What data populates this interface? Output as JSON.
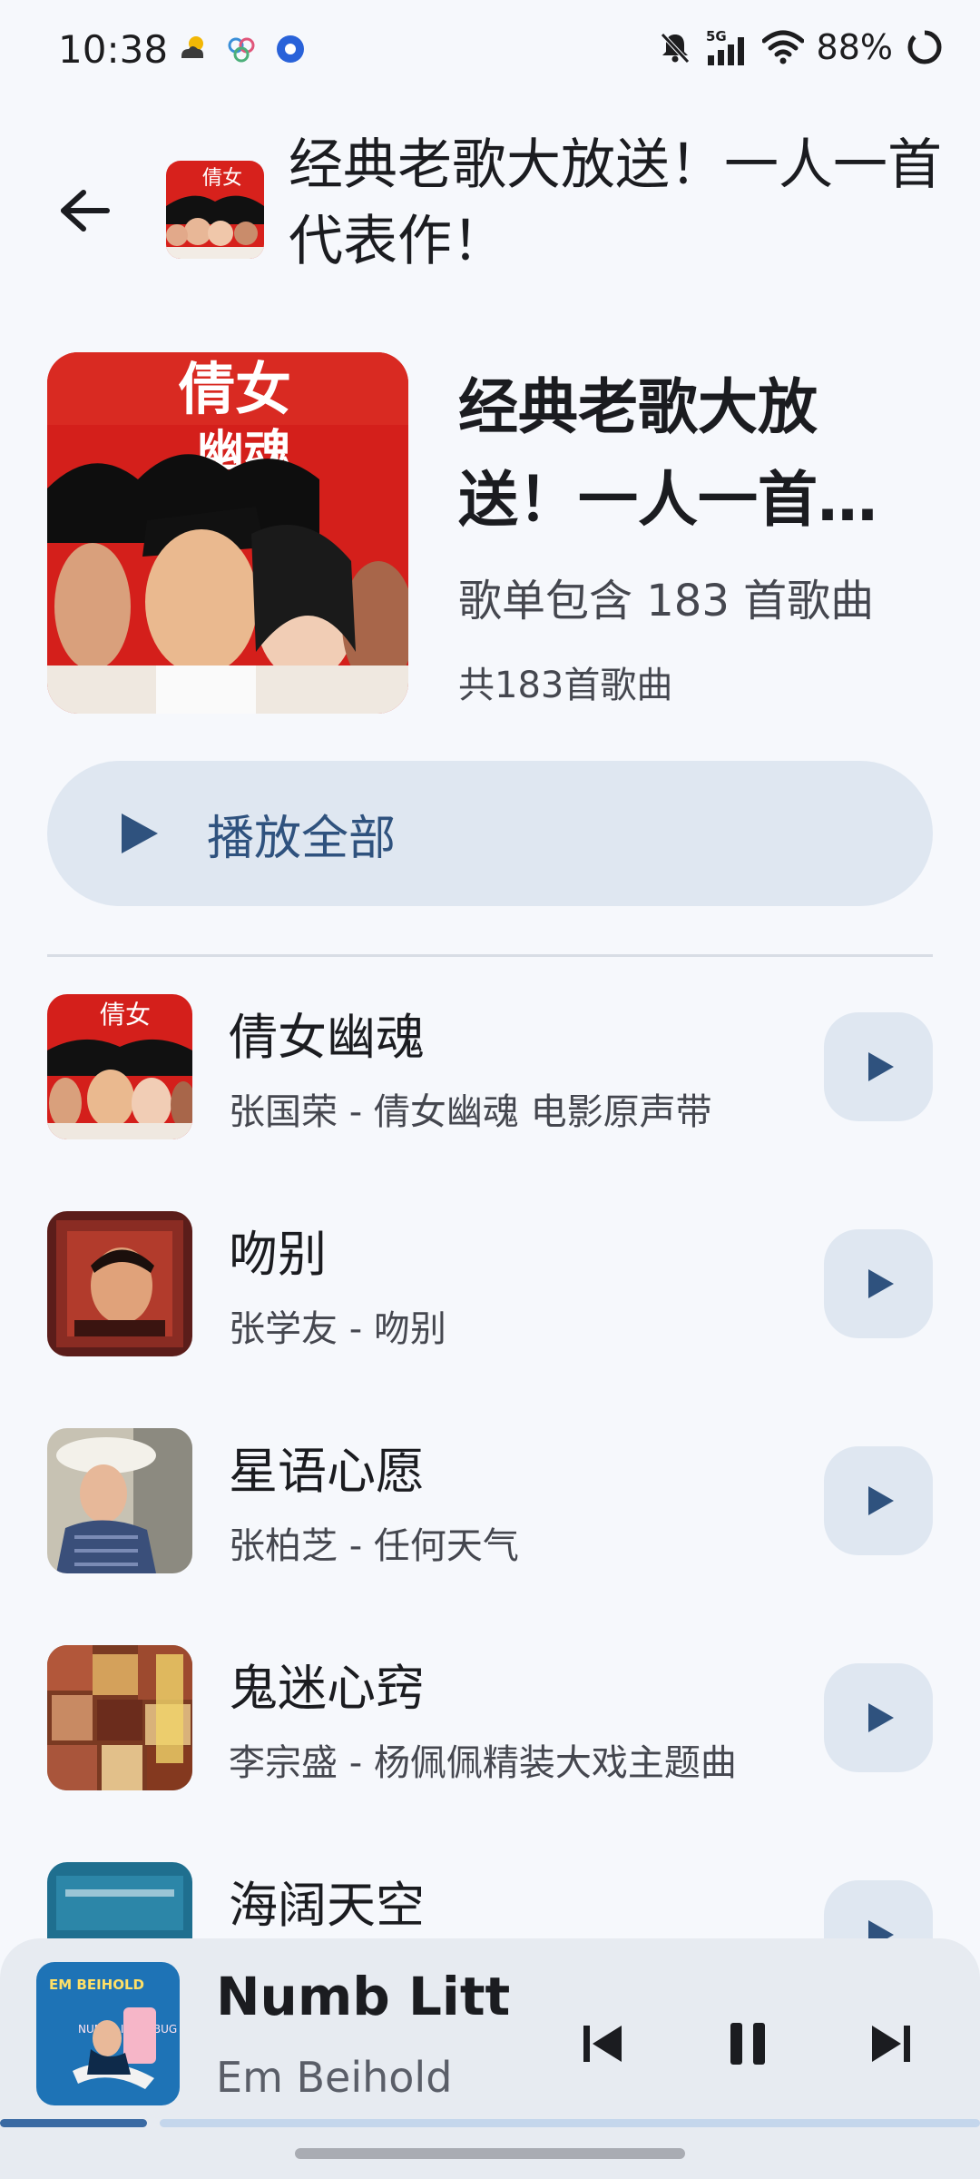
{
  "status_bar": {
    "time": "10:38",
    "battery": "88%",
    "network": "5G"
  },
  "top_bar": {
    "title": "经典老歌大放送！一人一首代表作！"
  },
  "header": {
    "title": "经典老歌大放送！一人一首代表作！",
    "description": "歌单包含 183 首歌曲",
    "count": "共183首歌曲"
  },
  "play_all": {
    "label": "播放全部"
  },
  "songs": [
    {
      "title": "倩女幽魂",
      "subtitle": "张国荣 - 倩女幽魂 电影原声带"
    },
    {
      "title": "吻别",
      "subtitle": "张学友 - 吻别"
    },
    {
      "title": "星语心愿",
      "subtitle": "张柏芝 - 任何天气"
    },
    {
      "title": "鬼迷心窍",
      "subtitle": "李宗盛 - 杨佩佩精装大戏主题曲"
    },
    {
      "title": "海阔天空",
      "subtitle": ""
    }
  ],
  "now_playing": {
    "title": "Numb Litt",
    "artist": "Em Beihold",
    "progress": 0.15,
    "cover_text_top": "EM BEIHOLD",
    "cover_text_mid": "NUMB LITTLE BUG"
  },
  "colors": {
    "background": "#f6f8fc",
    "tonal_container": "#dfe7f1",
    "accent": "#2f527e",
    "progress": "#3a6aa3"
  },
  "icons": {
    "back": "arrow-left-icon",
    "play": "play-icon",
    "previous": "skip-previous-icon",
    "pause": "pause-icon",
    "next": "skip-next-icon"
  }
}
